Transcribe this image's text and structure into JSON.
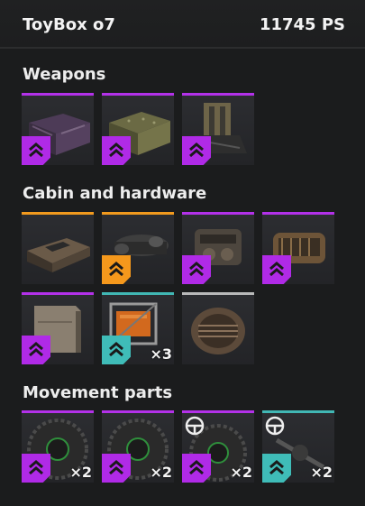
{
  "header": {
    "title": "ToyBox o7",
    "ps": "11745 PS"
  },
  "rarity_colors": {
    "epic": "#b331e9",
    "legendary": "#f29a1e",
    "rare": "#41b7b4",
    "common": "#b9b9b9"
  },
  "sections": [
    {
      "title": "Weapons",
      "items": [
        {
          "icon": "ammo-crate-purple-icon",
          "rarity": "epic",
          "count": ""
        },
        {
          "icon": "ammo-crate-green-icon",
          "rarity": "epic",
          "count": ""
        },
        {
          "icon": "mounted-turret-icon",
          "rarity": "epic",
          "count": ""
        }
      ]
    },
    {
      "title": "Cabin and hardware",
      "items": [
        {
          "icon": "cabin-icon",
          "rarity": "legendary",
          "count": ""
        },
        {
          "icon": "engine-icon",
          "rarity": "legendary",
          "count": ""
        },
        {
          "icon": "generator-icon",
          "rarity": "epic",
          "count": ""
        },
        {
          "icon": "radiator-engine-icon",
          "rarity": "epic",
          "count": ""
        },
        {
          "icon": "armor-box-icon",
          "rarity": "epic",
          "count": ""
        },
        {
          "icon": "fuel-tank-icon",
          "rarity": "rare",
          "count": "×3"
        },
        {
          "icon": "cooler-drum-icon",
          "rarity": "common",
          "count": ""
        }
      ]
    },
    {
      "title": "Movement parts",
      "items": [
        {
          "icon": "wheel-icon",
          "rarity": "epic",
          "count": "×2"
        },
        {
          "icon": "wheel-icon",
          "rarity": "epic",
          "count": "×2"
        },
        {
          "icon": "steering-wheel-icon",
          "rarity": "epic",
          "count": "×2"
        },
        {
          "icon": "steering-axle-icon",
          "rarity": "rare",
          "count": "×2"
        }
      ]
    }
  ]
}
